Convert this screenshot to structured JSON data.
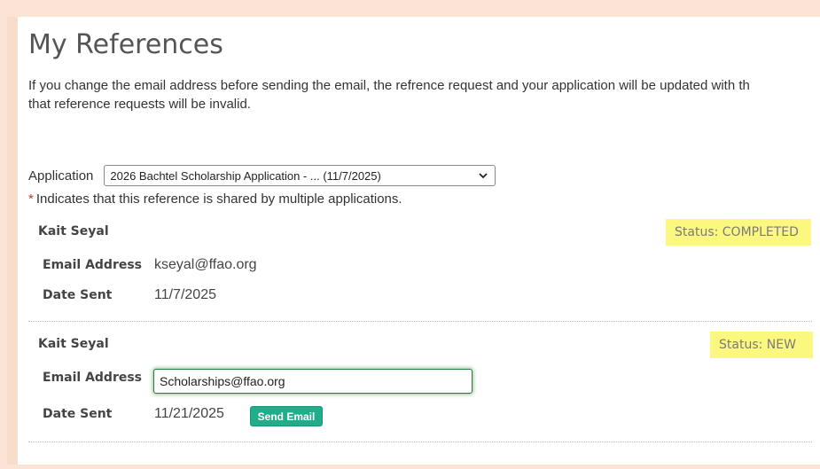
{
  "page": {
    "title": "My References",
    "intro_line1": "If you change the email address before sending the email, the refrence request and your application will be updated with th",
    "intro_line2": "that reference requests will be invalid."
  },
  "application": {
    "label": "Application",
    "selected": "2026 Bachtel Scholarship Application - ... (11/7/2025)"
  },
  "shared_note": {
    "asterisk": "*",
    "text": "Indicates that this reference is shared by multiple applications."
  },
  "references": [
    {
      "name": "Kait Seyal",
      "status": "Status: COMPLETED",
      "email_label": "Email Address",
      "email": "kseyal@ffao.org",
      "date_label": "Date Sent",
      "date_sent": "11/7/2025"
    },
    {
      "name": "Kait Seyal",
      "status": "Status: NEW",
      "email_label": "Email Address",
      "email": "Scholarships@ffao.org",
      "date_label": "Date Sent",
      "date_sent": "11/21/2025",
      "send_label": "Send Email"
    }
  ],
  "colors": {
    "status_highlight": "#fcf77e",
    "send_button": "#21ad8a",
    "frame": "#fbe4d5"
  },
  "icons": {
    "select_arrow": "chevron-down-icon"
  }
}
